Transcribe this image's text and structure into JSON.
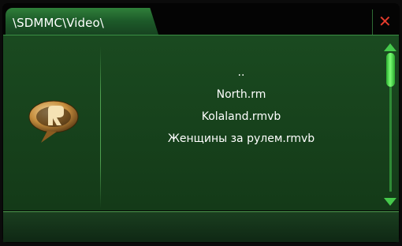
{
  "window": {
    "path": "\\SDMMC\\Video\\",
    "close_glyph": "✕"
  },
  "player": {
    "icon": "realplayer-logo-icon"
  },
  "files": [
    {
      "name": ".."
    },
    {
      "name": "North.rm"
    },
    {
      "name": "Kolaland.rmvb"
    },
    {
      "name": "Женщины за рулем.rmvb"
    }
  ],
  "scrollbar": {
    "position": 0.0
  },
  "colors": {
    "accent_green": "#46c94c",
    "panel_green": "#1a4a20",
    "close_red": "#e53b2c"
  }
}
